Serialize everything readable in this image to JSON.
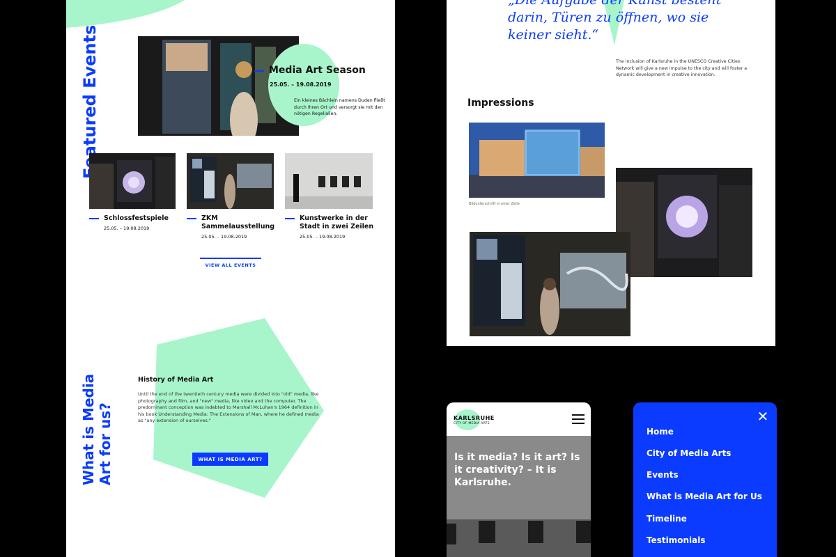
{
  "featured": {
    "heading": "Featured Events",
    "hero": {
      "title": "Media Art Season",
      "date": "25.05. – 19.08.2019",
      "description": "Ein kleines Bächlein namens Duden fließt durch ihren Ort und versorgt sie mit den nötigen Regelialien."
    },
    "events": [
      {
        "title": "Schlossfestspiele",
        "date": "25.05. – 19.08.2019"
      },
      {
        "title": "ZKM Sammelausstellung",
        "date": "25.05. – 19.08.2019"
      },
      {
        "title": "Kunstwerke in der Stadt in zwei Zeilen",
        "date": "25.05. – 19.08.2019"
      }
    ],
    "view_all_label": "VIEW ALL EVENTS"
  },
  "what": {
    "heading": "What is Media Art for us?",
    "subheading": "History of Media Art",
    "body": "Until the end of the twentieth century media were divided into \"old\" media, like photography and film, and \"new\" media, like video and the computer. The predominant conception was indebted to Marshall McLuhan's 1964 definition in his book Understanding Media: The Extensions of Man, where he defined media as \"any extension of ourselves.\"",
    "button_label": "WHAT IS MEDIA ART?"
  },
  "right": {
    "quote": "„Die Aufgabe der Kunst besteht darin, Türen zu öffnen, wo sie keiner sieht.“",
    "quote_note": "The inclusion of Karlsruhe in the UNESCO Creative Cities Network will give a new impulse to the city and will foster a dynamic development in creative innovation.",
    "impressions_heading": "Impressions",
    "caption": "Bildunterschrift in einer Zeile"
  },
  "mobile": {
    "logo_main": "KARLSRUHE",
    "logo_sub": "CITY OF MEDIA ARTS",
    "hero_text": "Is it media? Is it art? Is it creativity? – It is Karlsruhe."
  },
  "menu": {
    "items": [
      "Home",
      "City of Media Arts",
      "Events",
      "What is Media Art for Us",
      "Timeline",
      "Testimonials"
    ]
  },
  "colors": {
    "accent": "#0a3bff",
    "mint": "#a8f5cc"
  }
}
